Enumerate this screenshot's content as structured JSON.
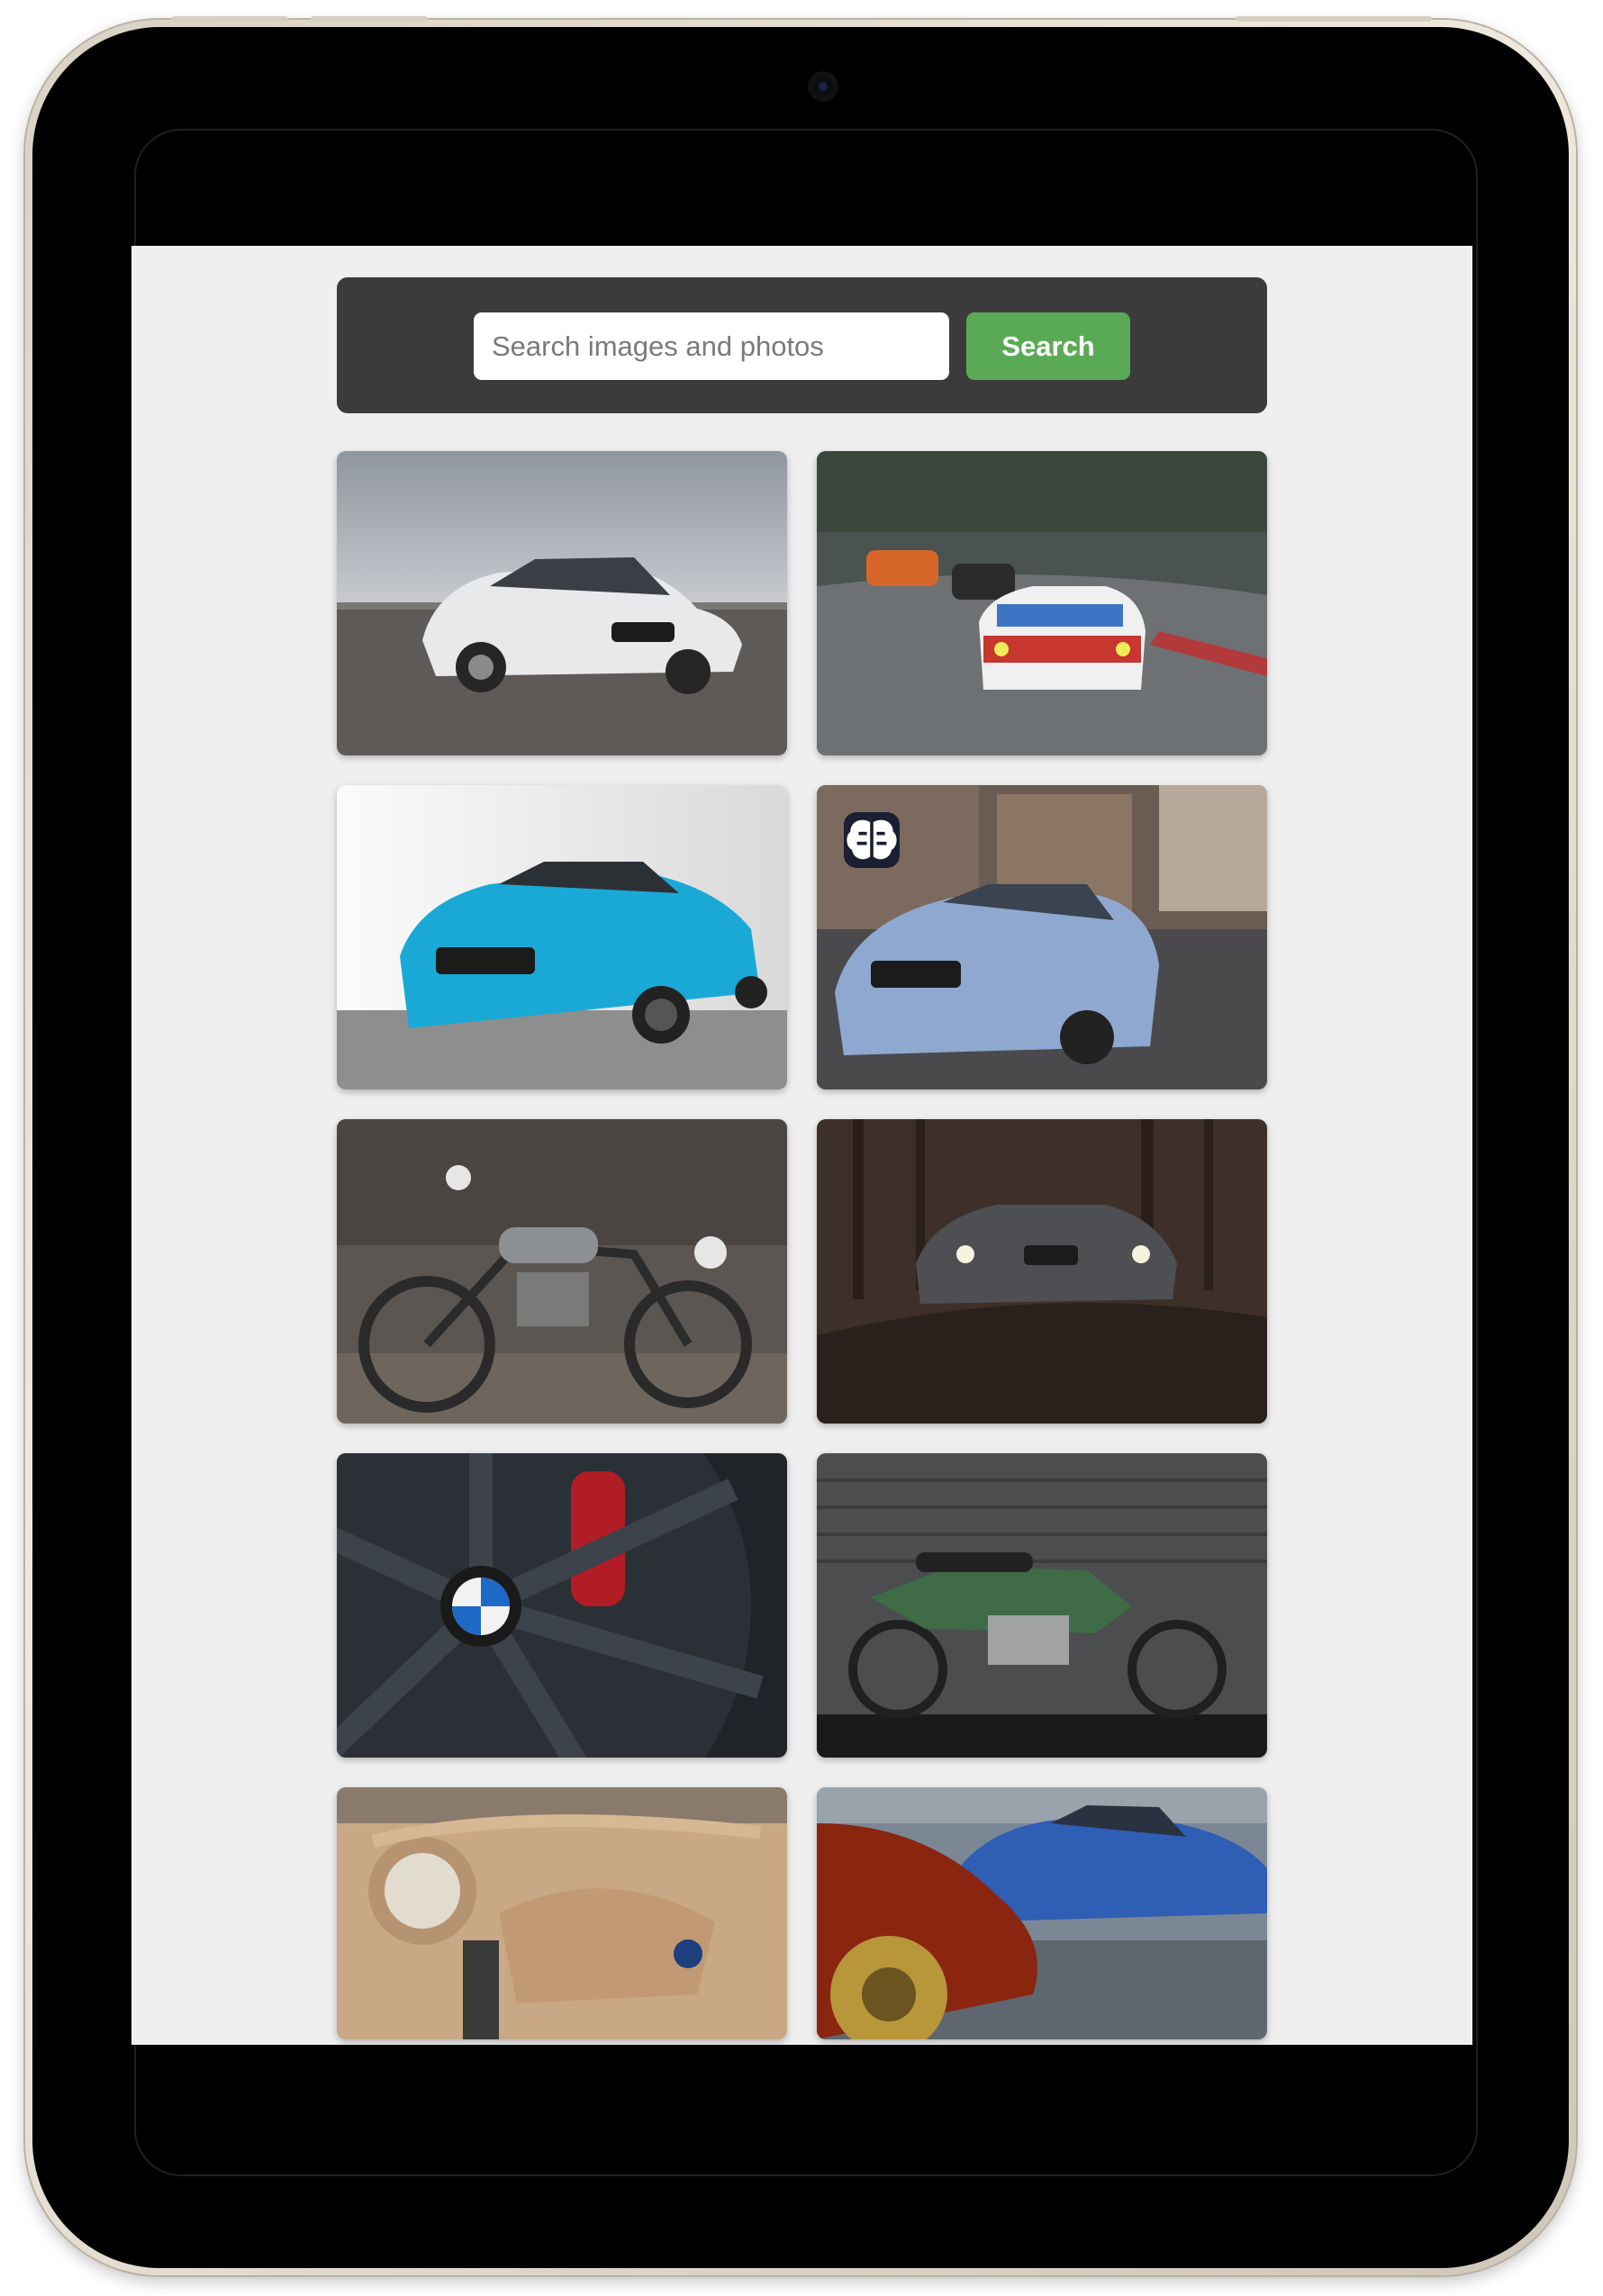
{
  "search": {
    "placeholder": "Search images and photos",
    "button_label": "Search"
  },
  "images": [
    {
      "subject": "white BMW M4 coupe on runway"
    },
    {
      "subject": "BMW race car leading cars on racetrack"
    },
    {
      "subject": "blue BMW M4 in studio"
    },
    {
      "subject": "light blue BMW M4 on city street",
      "badge": "brain-icon"
    },
    {
      "subject": "vintage BMW racing motorcycle number 26"
    },
    {
      "subject": "dark BMW sedan in autumn forest"
    },
    {
      "subject": "BMW alloy wheel close-up with red caliper"
    },
    {
      "subject": "green vintage BMW motorcycle"
    },
    {
      "subject": "tan vintage BMW motorcycle with sidecar"
    },
    {
      "subject": "red BMW with gold wheels and blue BMW M3 behind"
    }
  ],
  "colors": {
    "screen_bg": "#efefef",
    "search_panel": "#3b3b3b",
    "search_button": "#5aaa55",
    "bezel": "#000000"
  }
}
